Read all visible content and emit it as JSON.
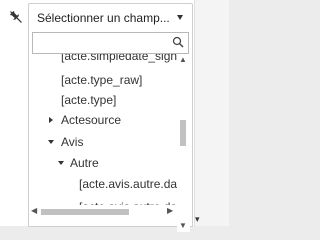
{
  "field_selector": {
    "placeholder_label": "Sélectionner un champ...",
    "search": {
      "value": ""
    }
  },
  "tree": [
    {
      "label": "[acte.simpledate_signature]",
      "depth": 0,
      "expander": "none"
    },
    {
      "label": "[acte.type_raw]",
      "depth": 0,
      "expander": "none"
    },
    {
      "label": "[acte.type]",
      "depth": 0,
      "expander": "none"
    },
    {
      "label": "Actesource",
      "depth": 0,
      "expander": "collapsed"
    },
    {
      "label": "Avis",
      "depth": 0,
      "expander": "expanded"
    },
    {
      "label": "Autre",
      "depth": 1,
      "expander": "expanded"
    },
    {
      "label": "[acte.avis.autre.date_envoi",
      "depth": 2,
      "expander": "none"
    },
    {
      "label": "[acte.avis.autre.date_limite",
      "depth": 2,
      "expander": "none"
    }
  ],
  "icons": {
    "pin": "pin-icon",
    "dropdown_caret": "chevron-down-icon",
    "search": "search-icon"
  }
}
